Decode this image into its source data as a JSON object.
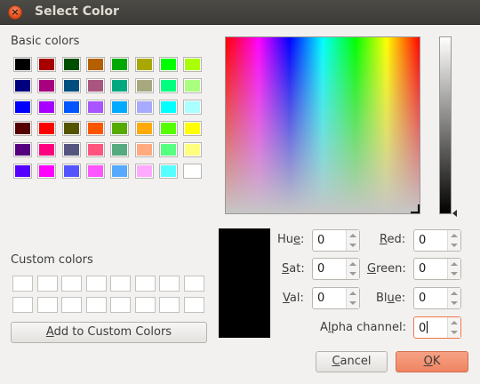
{
  "window": {
    "title": "Select Color",
    "close_glyph": "×"
  },
  "basic_colors": {
    "label_pre": "",
    "label_accel": "B",
    "label_post": "asic colors",
    "colors": [
      [
        "#000000",
        "#a80000",
        "#004e00",
        "#b45f00",
        "#00a800",
        "#a8a800",
        "#00ff00",
        "#aaff00"
      ],
      [
        "#00007f",
        "#a8007f",
        "#004e7f",
        "#a8557f",
        "#00a87f",
        "#a8a87f",
        "#00ff7f",
        "#aaff7f"
      ],
      [
        "#0000ff",
        "#a800ff",
        "#0055ff",
        "#a855ff",
        "#00aaff",
        "#a8aaff",
        "#00ffff",
        "#aaffff"
      ],
      [
        "#550000",
        "#ff0000",
        "#555500",
        "#ff5500",
        "#55aa00",
        "#ffaa00",
        "#55ff00",
        "#ffff00"
      ],
      [
        "#55007f",
        "#ff007f",
        "#55557f",
        "#ff557f",
        "#55aa7f",
        "#ffaa7f",
        "#55ff7f",
        "#ffff7f"
      ],
      [
        "#5500ff",
        "#ff00ff",
        "#5555ff",
        "#ff55ff",
        "#55aaff",
        "#ffaaff",
        "#55ffff",
        "#ffffff"
      ]
    ]
  },
  "custom_colors": {
    "label_pre": "",
    "label_accel": "C",
    "label_post": "ustom colors",
    "rows": 2,
    "cols": 8
  },
  "add_button": {
    "pre": "",
    "accel": "A",
    "post": "dd to Custom Colors"
  },
  "fields": {
    "hue": {
      "pre": "Hu",
      "accel": "e",
      "post": ":",
      "value": "0"
    },
    "sat": {
      "pre": "",
      "accel": "S",
      "post": "at:",
      "value": "0"
    },
    "val": {
      "pre": "",
      "accel": "V",
      "post": "al:",
      "value": "0"
    },
    "red": {
      "pre": "",
      "accel": "R",
      "post": "ed:",
      "value": "0"
    },
    "green": {
      "pre": "",
      "accel": "G",
      "post": "reen:",
      "value": "0"
    },
    "blue": {
      "pre": "Bl",
      "accel": "u",
      "post": "e:",
      "value": "0"
    },
    "alpha": {
      "pre": "A",
      "accel": "l",
      "post": "pha channel:",
      "value": "0"
    }
  },
  "buttons": {
    "cancel": {
      "pre": "",
      "accel": "C",
      "post": "ancel"
    },
    "ok": {
      "pre": "",
      "accel": "O",
      "post": "K"
    }
  },
  "current_color": "#000000"
}
